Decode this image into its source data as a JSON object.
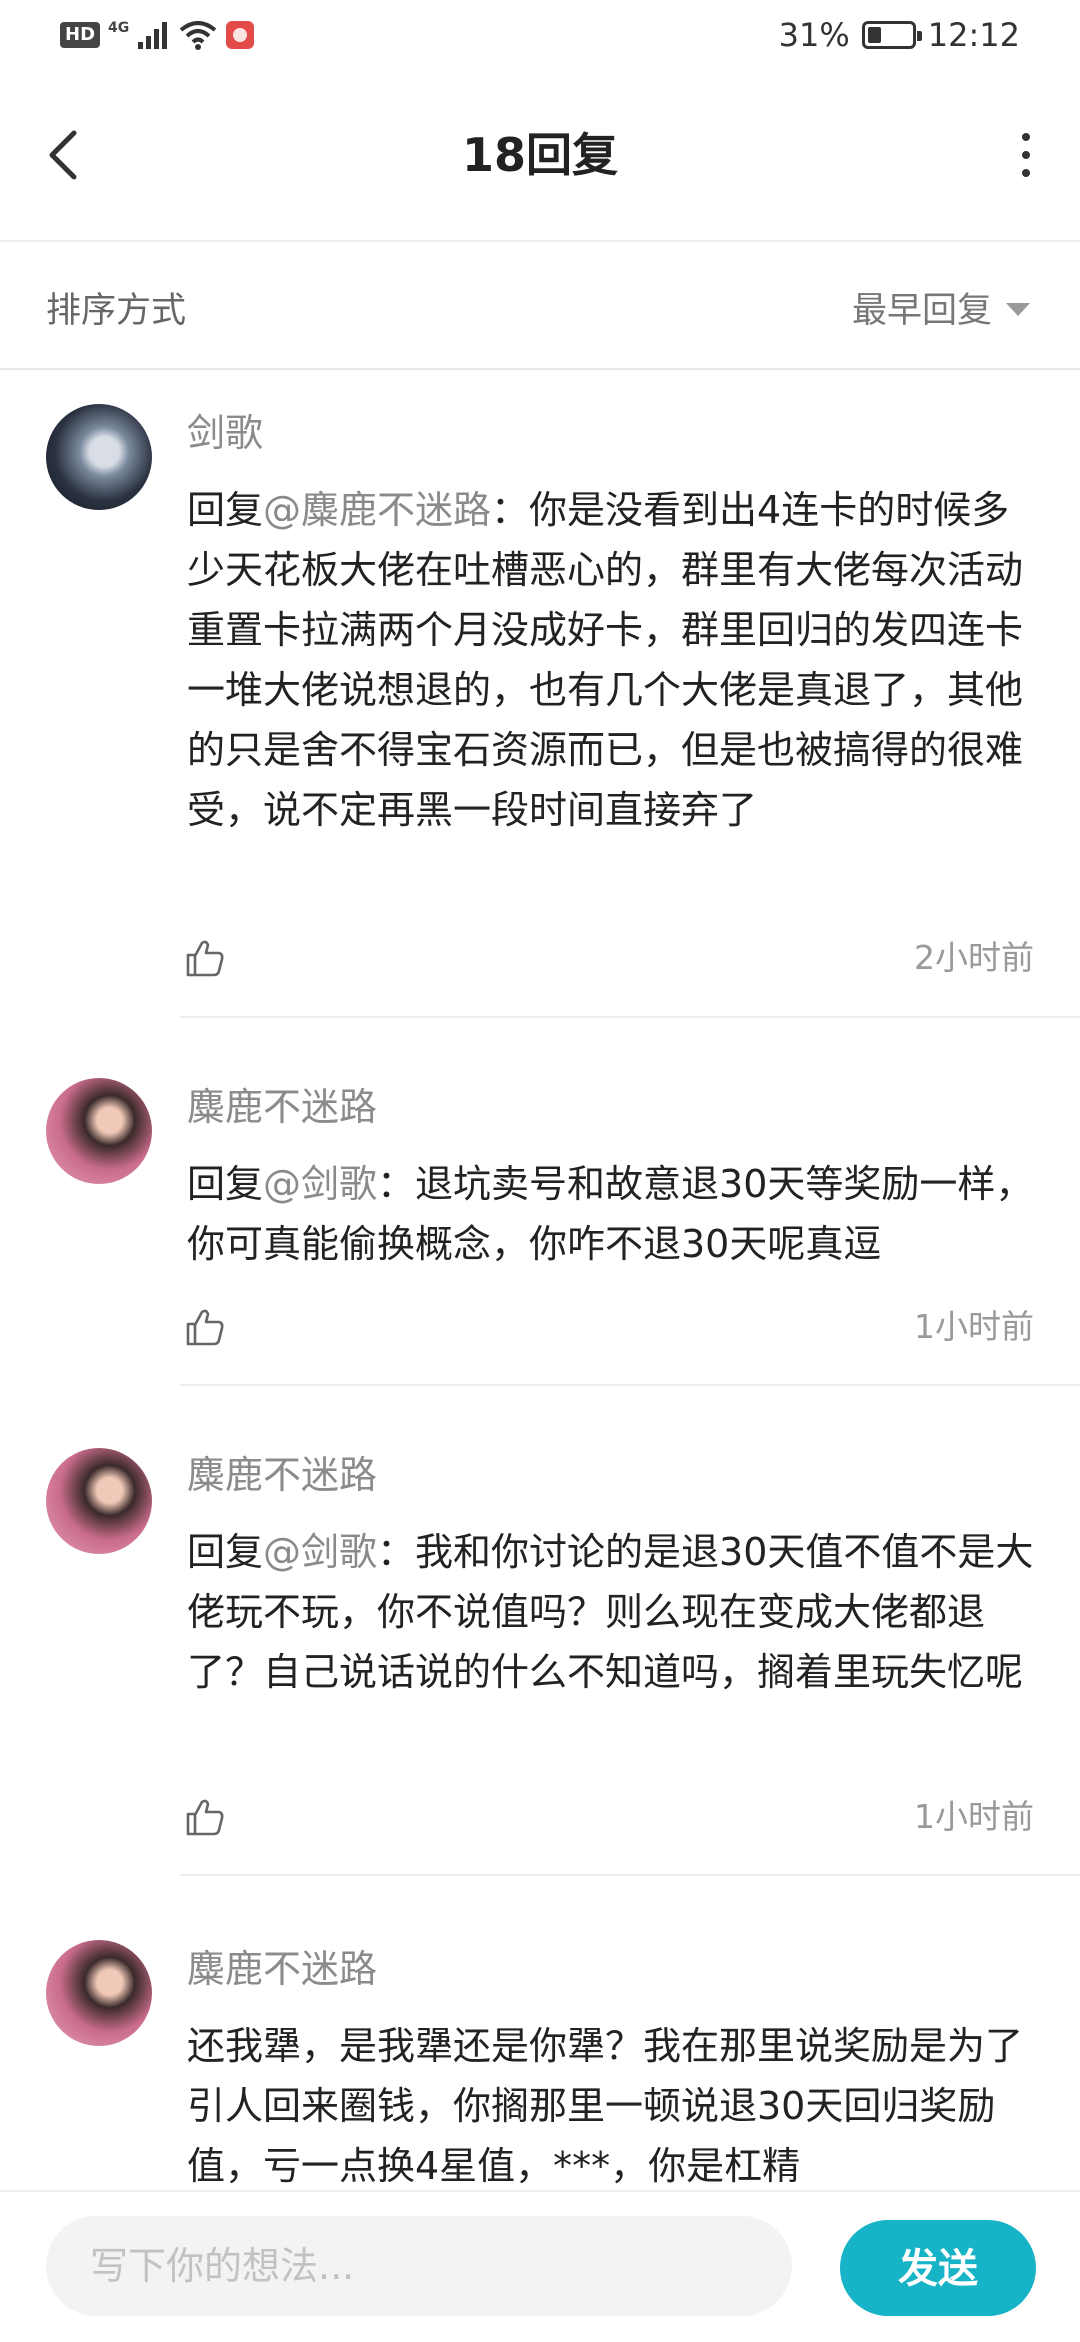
{
  "status_bar": {
    "hd": "HD",
    "network": "4G",
    "battery_percent": "31%",
    "battery_level": 0.31,
    "time": "12:12"
  },
  "header": {
    "title": "18回复"
  },
  "sort": {
    "label": "排序方式",
    "selected": "最早回复"
  },
  "replies": [
    {
      "name": "剑歌",
      "reply_prefix": "回复",
      "mention": "@麋鹿不迷路",
      "text": "：你是没看到出4连卡的时候多少天花板大佬在吐槽恶心的，群里有大佬每次活动重置卡拉满两个月没成好卡，群里回归的发四连卡一堆大佬说想退的，也有几个大佬是真退了，其他的只是舍不得宝石资源而已，但是也被搞得的很难受，说不定再黑一段时间直接弃了",
      "time": "2小时前"
    },
    {
      "name": "麋鹿不迷路",
      "reply_prefix": "回复",
      "mention": "@剑歌",
      "text": "：退坑卖号和故意退30天等奖励一样，你可真能偷换概念，你咋不退30天呢真逗",
      "time": "1小时前"
    },
    {
      "name": "麋鹿不迷路",
      "reply_prefix": "回复",
      "mention": "@剑歌",
      "text": "：我和你讨论的是退30天值不值不是大佬玩不玩，你不说值吗？则么现在变成大佬都退了？自己说话说的什么不知道吗，搁着里玩失忆呢",
      "time": "1小时前"
    },
    {
      "name": "麋鹿不迷路",
      "text": "还我犟，是我犟还是你犟？我在那里说奖励是为了引人回来圈钱，你搁那里一顿说退30天回归奖励值，亏一点换4星值，***，你是杠精"
    }
  ],
  "composer": {
    "placeholder": "写下你的想法...",
    "send_label": "发送"
  },
  "colors": {
    "accent": "#17b3c7",
    "muted_text": "#8b8b8b"
  }
}
